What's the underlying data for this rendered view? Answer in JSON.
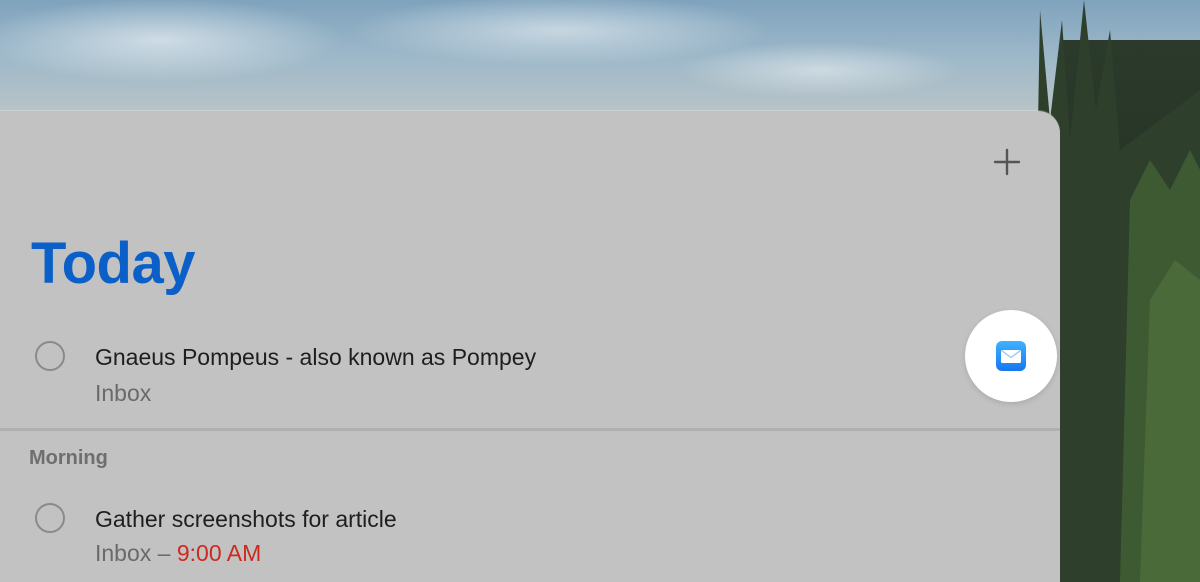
{
  "header": {
    "add_icon": "plus-icon"
  },
  "list": {
    "title": "Today",
    "title_color": "#0a5fc9",
    "tasks": [
      {
        "title": "Gnaeus Pompeus - also known as Pompey",
        "list": "Inbox"
      }
    ],
    "sections": [
      {
        "name": "Morning",
        "tasks": [
          {
            "title": "Gather screenshots for article",
            "list": "Inbox",
            "separator": " – ",
            "time": "9:00 AM",
            "time_color": "#cc2a20"
          }
        ]
      }
    ]
  },
  "attachment": {
    "icon": "mail-icon"
  }
}
